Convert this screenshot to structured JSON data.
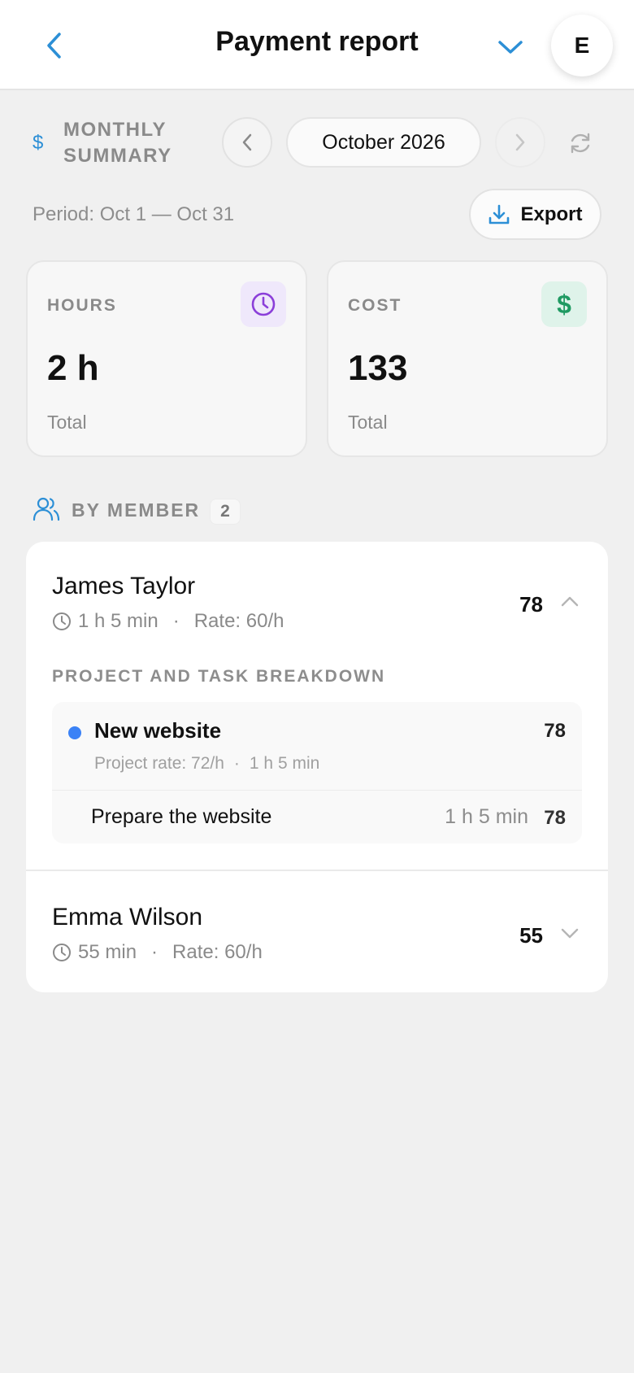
{
  "header": {
    "title": "Payment report",
    "avatar_initial": "E"
  },
  "summary": {
    "label": "MONTHLY SUMMARY",
    "month": "October 2026",
    "period": "Period: Oct 1 — Oct 31",
    "export_label": "Export"
  },
  "stats": {
    "hours": {
      "label": "HOURS",
      "value": "2 h",
      "sub": "Total"
    },
    "cost": {
      "label": "COST",
      "value": "133",
      "sub": "Total",
      "icon_symbol": "$"
    }
  },
  "members_section": {
    "label": "BY MEMBER",
    "count": "2"
  },
  "members": [
    {
      "name": "James Taylor",
      "time": "1 h 5 min",
      "separator": "·",
      "rate": "Rate: 60/h",
      "amount": "78",
      "expanded": true,
      "breakdown_title": "PROJECT AND TASK BREAKDOWN",
      "project": {
        "name": "New website",
        "amount": "78",
        "rate": "Project rate: 72/h",
        "separator": "·",
        "time": "1 h 5 min",
        "dot_color": "#3b82f6"
      },
      "task": {
        "name": "Prepare the website",
        "time": "1 h 5 min",
        "amount": "78"
      }
    },
    {
      "name": "Emma Wilson",
      "time": "55 min",
      "separator": "·",
      "rate": "Rate: 60/h",
      "amount": "55",
      "expanded": false
    }
  ],
  "colors": {
    "accent": "#2c8fd6",
    "background": "#f0f0f0",
    "hours_icon": "#8b3fd9",
    "cost_icon": "#1f9a62"
  }
}
